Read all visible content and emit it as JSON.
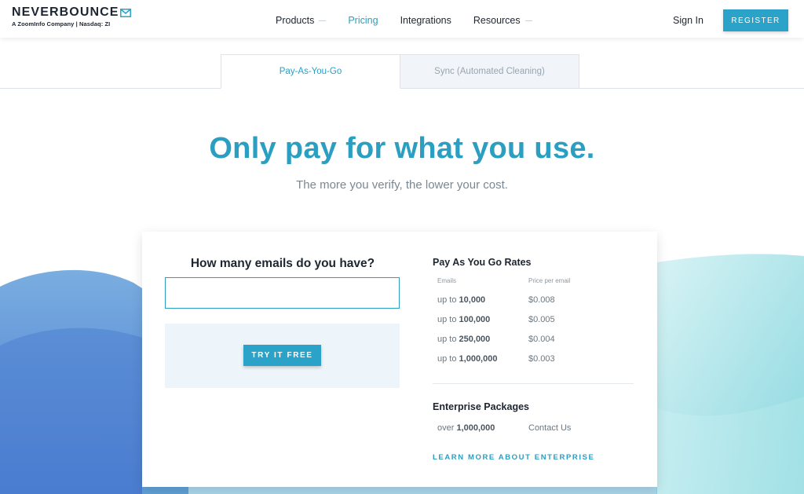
{
  "header": {
    "logo_text": "NEVERBOUNCE",
    "logo_subtitle": "A ZoomInfo Company | Nasdaq: ZI",
    "logo_icon": "envelope-icon",
    "nav": [
      {
        "label": "Products",
        "has_dropdown": true
      },
      {
        "label": "Pricing",
        "active": true
      },
      {
        "label": "Integrations"
      },
      {
        "label": "Resources",
        "has_dropdown": true
      }
    ],
    "sign_in": "Sign In",
    "register": "REGISTER"
  },
  "tabs": [
    {
      "label": "Pay-As-You-Go",
      "active": true
    },
    {
      "label": "Sync (Automated Cleaning)",
      "active": false
    }
  ],
  "hero": {
    "headline": "Only pay for what you use.",
    "subhead": "The more you verify, the lower your cost."
  },
  "calculator": {
    "question": "How many emails do you have?",
    "input_value": "",
    "try_button": "TRY IT FREE"
  },
  "rates": {
    "title": "Pay As You Go Rates",
    "col_emails": "Emails",
    "col_price": "Price per email",
    "rows": [
      {
        "prefix": "up to",
        "amount": "10,000",
        "price": "$0.008"
      },
      {
        "prefix": "up to",
        "amount": "100,000",
        "price": "$0.005"
      },
      {
        "prefix": "up to",
        "amount": "250,000",
        "price": "$0.004"
      },
      {
        "prefix": "up to",
        "amount": "1,000,000",
        "price": "$0.003"
      }
    ]
  },
  "enterprise": {
    "title": "Enterprise Packages",
    "prefix": "over",
    "amount": "1,000,000",
    "price": "Contact Us",
    "link": "LEARN MORE ABOUT ENTERPRISE"
  },
  "colors": {
    "accent": "#2ba3c8",
    "heading_text": "#1d2530",
    "wave_blue": "#4f86d0",
    "wave_teal": "#8fdbe0"
  }
}
